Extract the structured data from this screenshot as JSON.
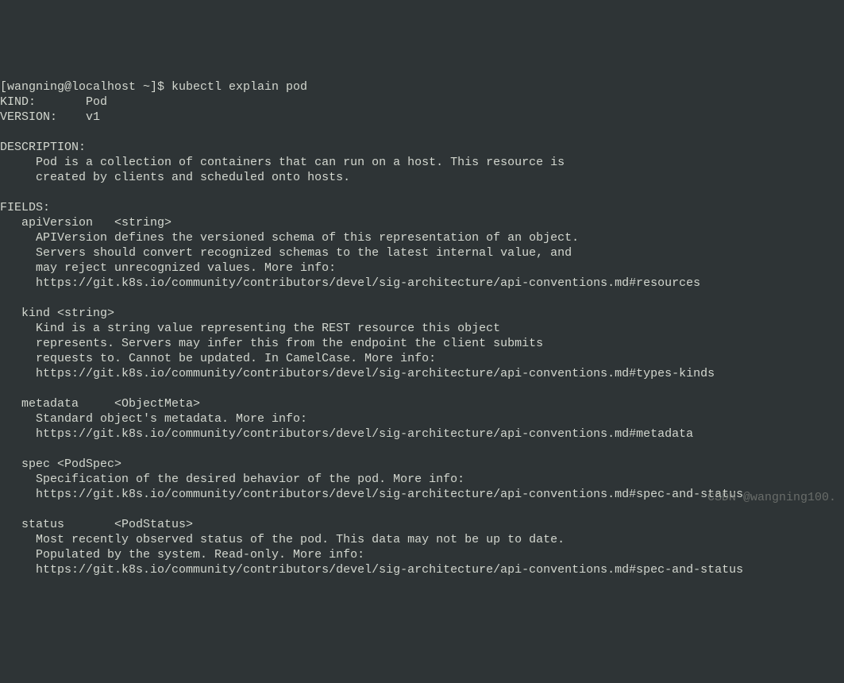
{
  "prompt": "[wangning@localhost ~]$ kubectl explain pod",
  "kind_line": "KIND:       Pod",
  "version_line": "VERSION:    v1",
  "description_header": "DESCRIPTION:",
  "description_l1": "     Pod is a collection of containers that can run on a host. This resource is",
  "description_l2": "     created by clients and scheduled onto hosts.",
  "fields_header": "FIELDS:",
  "apiVersion_header": "   apiVersion   <string>",
  "apiVersion_l1": "     APIVersion defines the versioned schema of this representation of an object.",
  "apiVersion_l2": "     Servers should convert recognized schemas to the latest internal value, and",
  "apiVersion_l3": "     may reject unrecognized values. More info:",
  "apiVersion_l4": "     https://git.k8s.io/community/contributors/devel/sig-architecture/api-conventions.md#resources",
  "kind_header": "   kind <string>",
  "kind_l1": "     Kind is a string value representing the REST resource this object",
  "kind_l2": "     represents. Servers may infer this from the endpoint the client submits",
  "kind_l3": "     requests to. Cannot be updated. In CamelCase. More info:",
  "kind_l4": "     https://git.k8s.io/community/contributors/devel/sig-architecture/api-conventions.md#types-kinds",
  "metadata_header": "   metadata     <ObjectMeta>",
  "metadata_l1": "     Standard object's metadata. More info:",
  "metadata_l2": "     https://git.k8s.io/community/contributors/devel/sig-architecture/api-conventions.md#metadata",
  "spec_header": "   spec <PodSpec>",
  "spec_l1": "     Specification of the desired behavior of the pod. More info:",
  "spec_l2": "     https://git.k8s.io/community/contributors/devel/sig-architecture/api-conventions.md#spec-and-status",
  "status_header": "   status       <PodStatus>",
  "status_l1": "     Most recently observed status of the pod. This data may not be up to date.",
  "status_l2": "     Populated by the system. Read-only. More info:",
  "status_l3": "     https://git.k8s.io/community/contributors/devel/sig-architecture/api-conventions.md#spec-and-status",
  "watermark": "CSDN @wangning100."
}
